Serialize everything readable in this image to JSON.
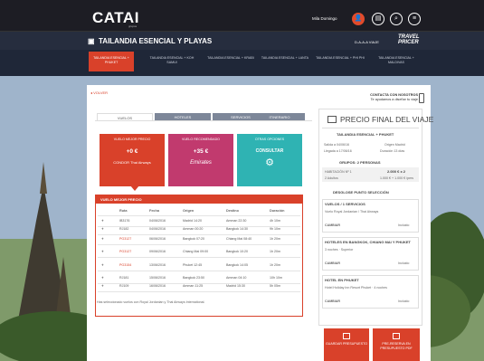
{
  "header": {
    "logo": "CATAI",
    "logo_sub": "grupos",
    "user": "Mila Domingo",
    "user_avatar": "👤",
    "icons": [
      "agenda-icon",
      "search-icon",
      "menu-icon"
    ]
  },
  "trip": {
    "title": "TAILANDIA ESENCIAL Y PLAYAS",
    "voyage_label": "D-A-A-A VIAJE",
    "partner": "TRAVEL PRICER"
  },
  "tabs": [
    "TAILANDIA ESENCIAL + PHUKET",
    "TAILANDIA ESENCIAL + KOH SAMUI",
    "TAILANDIA ESENCIAL + KRABI",
    "TAILANDIA ESENCIAL + LANTA",
    "TAILANDIA ESENCIAL + PHI PHI",
    "TAILANDIA ESENCIAL + MALDIVAS"
  ],
  "main": {
    "back": "VOLVER",
    "contact_line1": "CONTACTA CON NOSOTROS",
    "contact_line2": "Te ayudamos a diseñar tu viaje",
    "left_tabs": [
      "VUELOS",
      "HOTELES",
      "SERVICIOS",
      "ITINERARIO"
    ],
    "cards": [
      {
        "head": "VUELO MEJOR PRECIO",
        "value": "+0 €",
        "brand": "CONDOR Thai Airways"
      },
      {
        "head": "VUELO RECOMENDADO",
        "value": "+35 €",
        "brand": "Emirates"
      },
      {
        "head": "OTRAS OPCIONES",
        "value": "CONSULTAR",
        "brand": ""
      }
    ],
    "flights_title": "VUELO MEJOR PRECIO",
    "columns": [
      "Ruta",
      "Fecha",
      "Origen",
      "Destino",
      "Duración"
    ],
    "rows": [
      {
        "ruta": "IB3176",
        "fecha": "04/06/2016",
        "origen": "Madrid 14:20",
        "destino": "Amman 22:30",
        "dur": "4h 10m"
      },
      {
        "ruta": "RJ182",
        "fecha": "04/06/2016",
        "origen": "Amman 00:20",
        "destino": "Bangkok 14:30",
        "dur": "9h 10m"
      },
      {
        "ruta": "PG3127",
        "fecha": "06/06/2016",
        "origen": "Bangkok 07:20",
        "destino": "Chiang Mai 08:40",
        "dur": "1h 20m"
      },
      {
        "ruta": "PG3127",
        "fecha": "09/06/2016",
        "origen": "Chiang Mai 09:00",
        "destino": "Bangkok 10:20",
        "dur": "1h 20m"
      },
      {
        "ruta": "PG3154",
        "fecha": "13/06/2016",
        "origen": "Phuket 12:45",
        "destino": "Bangkok 14:05",
        "dur": "1h 20m"
      },
      {
        "ruta": "RJ181",
        "fecha": "15/06/2016",
        "origen": "Bangkok 23:50",
        "destino": "Amman 04:10",
        "dur": "10h 10m"
      },
      {
        "ruta": "RJ109",
        "fecha": "16/06/2016",
        "origen": "Amman 11:25",
        "destino": "Madrid 15:30",
        "dur": "5h 05m"
      }
    ],
    "note": "Has seleccionado vuelos con Royal Jordanian y Thai Airways International."
  },
  "summary": {
    "title": "PRECIO FINAL DEL VIAJE",
    "subtitle": "TAILANDIA ESENCIAL + PHUKET",
    "salida_label": "Salida a 04/06/16",
    "llegada_label": "Llegada a 17/06/16",
    "origen": "Origen Madrid",
    "duracion": "Duración 13 días",
    "pax_title": "GRUPOS: 2 PERSONAS",
    "price": "2.000 € x 2",
    "price_sub": "1.000 € + 1.000 € /pers",
    "hab": "HABITACIÓN Nº 1",
    "hab_sub": "2 Adultos",
    "selection_title": "DESGLOSE PUNTO SELECCIÓN",
    "services": [
      {
        "title": "VUELOS / 1 SERVICIOS",
        "desc": "Vuelo Royal Jordanian / Thai Airways",
        "action": "CAMBIAR",
        "status": "Incluido"
      },
      {
        "title": "HOTELES EN BANGKOK, CHIANG MAI Y PHUKET",
        "desc": "3 noches · Superior",
        "action": "CAMBIAR",
        "status": "Incluido"
      },
      {
        "title": "HOTEL EN PHUKET",
        "desc": "Hotel Holiday Inn Resort Phuket · 4 noches",
        "action": "CAMBIAR",
        "status": "Incluido"
      }
    ],
    "btn_save": "GUARDAR PRESUPUESTO",
    "btn_book": "PRE-RESERVA EN PRESUPUESTO PDF"
  }
}
